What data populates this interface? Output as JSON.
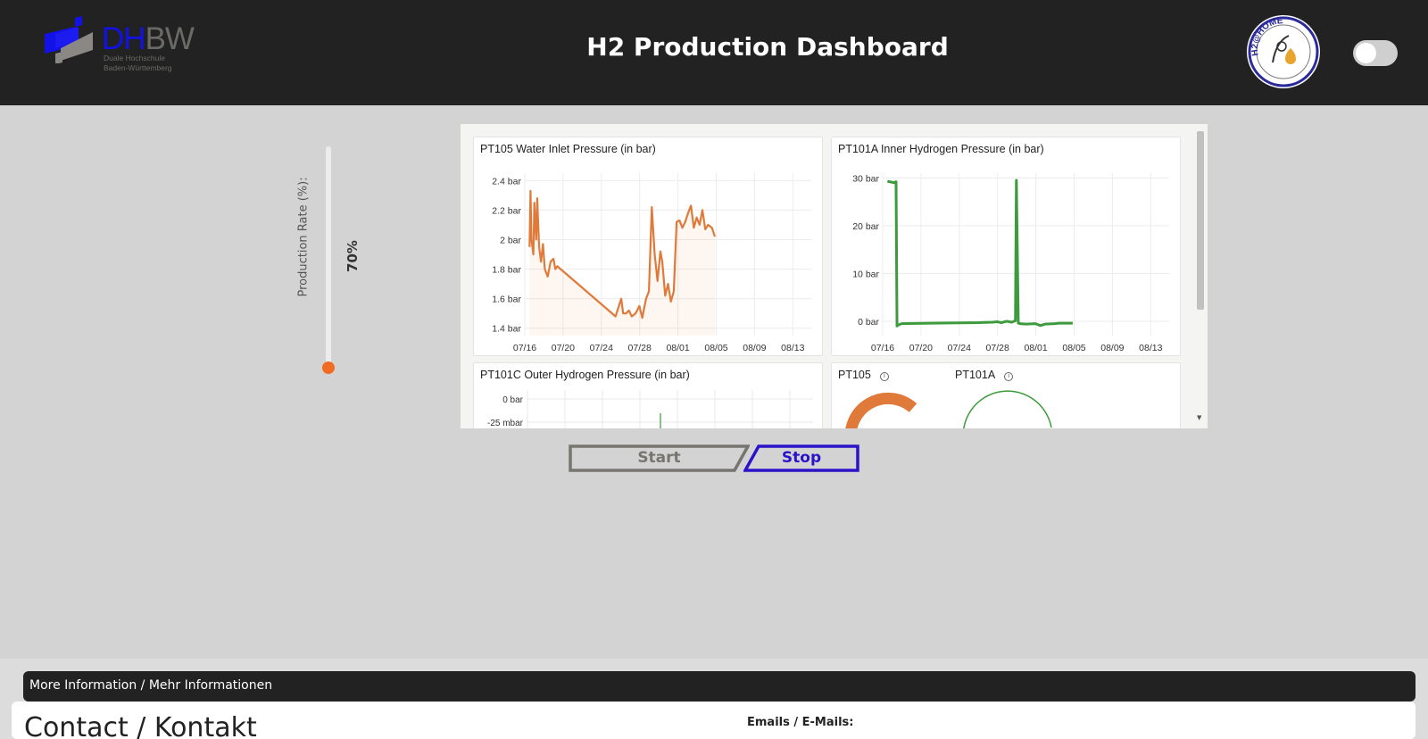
{
  "header": {
    "title": "H2 Production Dashboard",
    "logo": {
      "primary": "DH",
      "secondary": "BW",
      "subtitle_line1": "Duale Hochschule",
      "subtitle_line2": "Baden-Württemberg"
    },
    "seal": {
      "text": "H2@HOME",
      "icon": "hydrogen-drop-seal"
    },
    "theme_toggle": {
      "state": "off"
    }
  },
  "controls": {
    "production_rate_label": "Production Rate (%):",
    "production_rate_value": "70%",
    "production_rate_percent": 70,
    "start_label": "Start",
    "stop_label": "Stop"
  },
  "panels": [
    {
      "title": "PT105 Water Inlet Pressure (in bar)"
    },
    {
      "title": "PT101A Inner Hydrogen Pressure (in bar)"
    },
    {
      "title": "PT101C Outer Hydrogen Pressure (in bar)"
    },
    {
      "title": "PT105"
    },
    {
      "title": "PT101A"
    }
  ],
  "chart_data": [
    {
      "type": "area",
      "title": "PT105 Water Inlet Pressure (in bar)",
      "ylim": [
        1.35,
        2.45
      ],
      "y_ticks": [
        "1.4 bar",
        "1.6 bar",
        "1.8 bar",
        "2 bar",
        "2.2 bar",
        "2.4 bar"
      ],
      "y_tick_values": [
        1.4,
        1.6,
        1.8,
        2.0,
        2.2,
        2.4
      ],
      "x_ticks": [
        "07/16",
        "07/20",
        "07/24",
        "07/28",
        "08/01",
        "08/05",
        "08/09",
        "08/13"
      ],
      "x_range_days": [
        0,
        30
      ],
      "color": "#e07a3a",
      "series": [
        {
          "x": [
            0.5,
            0.6,
            0.7,
            0.9,
            1.0,
            1.2,
            1.3,
            1.5,
            1.7,
            1.9,
            2.1,
            2.4,
            2.7,
            3.0,
            3.2,
            3.4,
            9.5,
            9.9,
            10.1,
            10.3,
            10.6,
            10.9,
            11.2,
            11.6,
            12.0,
            12.3,
            12.7,
            13.0,
            13.3,
            13.6,
            13.9,
            14.2,
            14.4,
            14.7,
            15.0,
            15.3,
            15.6,
            15.9,
            16.2,
            16.5,
            16.8,
            17.1,
            17.4,
            17.7,
            18.0,
            18.3,
            18.6,
            18.9,
            19.2,
            19.6,
            19.9
          ],
          "y": [
            1.95,
            2.33,
            2.0,
            1.9,
            2.25,
            2.0,
            2.28,
            1.95,
            1.85,
            1.97,
            1.8,
            1.75,
            1.85,
            1.87,
            1.8,
            1.82,
            1.48,
            1.56,
            1.6,
            1.5,
            1.5,
            1.52,
            1.48,
            1.5,
            1.55,
            1.47,
            1.6,
            1.65,
            2.22,
            1.9,
            1.72,
            1.92,
            1.85,
            1.62,
            1.7,
            1.58,
            1.65,
            2.12,
            2.13,
            2.08,
            2.12,
            2.18,
            2.23,
            2.08,
            2.15,
            2.1,
            2.2,
            2.07,
            2.1,
            2.08,
            2.02
          ]
        }
      ]
    },
    {
      "type": "line",
      "title": "PT101A Inner Hydrogen Pressure (in bar)",
      "ylim": [
        -3,
        31
      ],
      "y_ticks": [
        "0 bar",
        "10 bar",
        "20 bar",
        "30 bar"
      ],
      "y_tick_values": [
        0,
        10,
        20,
        30
      ],
      "x_ticks": [
        "07/16",
        "07/20",
        "07/24",
        "07/28",
        "08/01",
        "08/05",
        "08/09",
        "08/13"
      ],
      "x_range_days": [
        0,
        30
      ],
      "color": "#3d9a3d",
      "series": [
        {
          "x": [
            0.5,
            1.2,
            1.4,
            1.5,
            1.6,
            2.0,
            5.0,
            10.0,
            11.5,
            12.0,
            12.4,
            13.0,
            13.5,
            13.9,
            14.0,
            14.2,
            14.4,
            15.0,
            16.0,
            16.5,
            17.0,
            18.0,
            18.5,
            19.9
          ],
          "y": [
            29.3,
            29.0,
            29.2,
            -1.0,
            -0.8,
            -0.5,
            -0.4,
            -0.3,
            -0.2,
            -0.1,
            -0.3,
            0.0,
            -0.2,
            0.1,
            29.5,
            -0.4,
            -0.5,
            -0.6,
            -0.5,
            -0.9,
            -0.6,
            -0.5,
            -0.4,
            -0.4
          ]
        }
      ]
    },
    {
      "type": "line",
      "title": "PT101C Outer Hydrogen Pressure (in bar)",
      "y_ticks": [
        "0 bar",
        "-25 mbar"
      ],
      "y_tick_values": [
        0,
        -0.025
      ],
      "color": "#3d9a3d",
      "series": []
    }
  ],
  "colors": {
    "header_bg": "#222222",
    "page_bg": "#d3d3d3",
    "accent_orange": "#f26b22",
    "stop_blue": "#2a13c8",
    "start_gray": "#77756f"
  },
  "footer": {
    "more_info": "More Information / Mehr Informationen",
    "contact_heading": "Contact / Kontakt",
    "emails_heading": "Emails / E-Mails:"
  }
}
